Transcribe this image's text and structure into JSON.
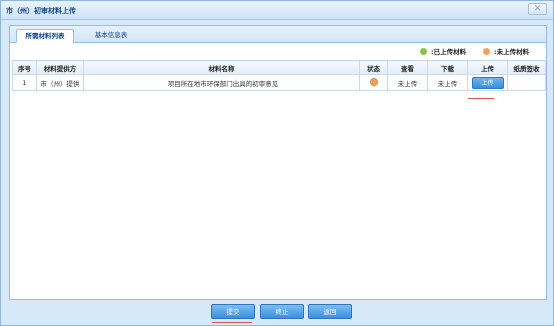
{
  "window": {
    "title": "市（州）初审材料上传",
    "close_glyph": "✕"
  },
  "tabs": [
    {
      "label": "所需材料列表",
      "active": true
    },
    {
      "label": "基本信息表",
      "active": false
    }
  ],
  "legend": {
    "uploaded": {
      "label": ":已上传材料",
      "color": "#8bc34a"
    },
    "not_uploaded": {
      "label": ":未上传材料",
      "color": "#f0a35e"
    }
  },
  "table": {
    "headers": [
      "序号",
      "材料提供方",
      "材料名称",
      "状态",
      "查看",
      "下载",
      "上传",
      "纸质签收"
    ],
    "rows": [
      {
        "index": "1",
        "provider": "市（州）提供",
        "name": "项目所在地市环保部门出具的初审意见",
        "status": "not_uploaded",
        "view": "未上传",
        "download": "未上传",
        "upload": "上传",
        "paper_receipt": ""
      }
    ]
  },
  "footer": {
    "submit": "提交",
    "stop": "终止",
    "back": "返回"
  },
  "colors": {
    "accent": "#3d8fe0",
    "header_text": "#15428b",
    "highlight_underline": "#d9534f"
  }
}
